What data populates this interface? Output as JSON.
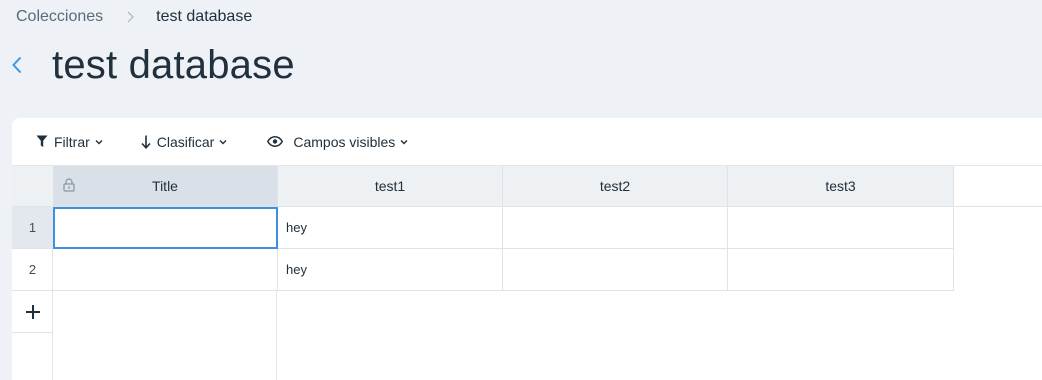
{
  "breadcrumb": {
    "parent": "Colecciones",
    "current": "test database"
  },
  "page": {
    "title": "test database"
  },
  "toolbar": {
    "filter_label": "Filtrar",
    "sort_label": "Clasificar",
    "fields_label": "Campos visibles"
  },
  "table": {
    "columns": [
      "Title",
      "test1",
      "test2",
      "test3"
    ],
    "rows": [
      {
        "num": "1",
        "cells": [
          "",
          "hey",
          "",
          ""
        ]
      },
      {
        "num": "2",
        "cells": [
          "",
          "hey",
          "",
          ""
        ]
      }
    ],
    "add_row_symbol": "+"
  },
  "colors": {
    "accent": "#3f8fe0",
    "background": "#eef1f5",
    "header": "#eef1f4",
    "title_header": "#d9e0e7"
  },
  "icons": {
    "back": "chevron-left-icon",
    "filter": "funnel-icon",
    "sort": "arrow-down-icon",
    "fields": "eye-icon",
    "lock": "lock-icon",
    "add": "plus-icon"
  }
}
